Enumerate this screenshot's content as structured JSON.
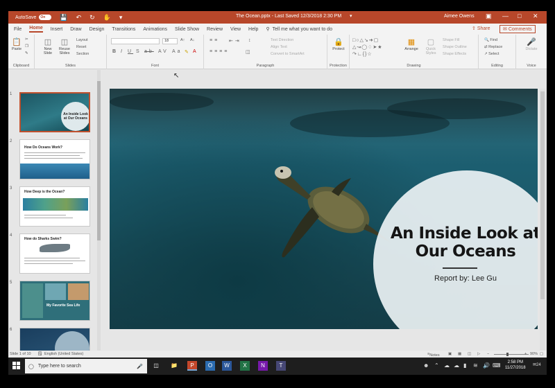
{
  "titlebar": {
    "autosave_label": "AutoSave",
    "autosave_state": "On",
    "title": "The Ocean.pptx  -  Last Saved  12/3/2018  2:30 PM",
    "user": "Aimee Owens"
  },
  "tabs": [
    "File",
    "Home",
    "Insert",
    "Draw",
    "Design",
    "Transitions",
    "Animations",
    "Slide Show",
    "Review",
    "View",
    "Help"
  ],
  "active_tab": "Home",
  "tell_me": "Tell me what you want to do",
  "share_label": "Share",
  "comments_label": "Comments",
  "ribbon": {
    "clipboard": {
      "label": "Clipboard",
      "paste": "Paste"
    },
    "slides": {
      "label": "Slides",
      "new_slide": "New Slide",
      "reuse_slides": "Reuse Slides",
      "layout": "Layout",
      "reset": "Reset",
      "section": "Section"
    },
    "font": {
      "label": "Font",
      "size": "18"
    },
    "paragraph": {
      "label": "Paragraph",
      "text_direction": "Text Direction",
      "align_text": "Align Text",
      "convert": "Convert to SmartArt"
    },
    "protection": {
      "label": "Protection",
      "protect": "Protect"
    },
    "drawing": {
      "label": "Drawing",
      "arrange": "Arrange",
      "quick_styles": "Quick Styles",
      "shape_fill": "Shape Fill",
      "shape_outline": "Shape Outline",
      "shape_effects": "Shape Effects"
    },
    "editing": {
      "label": "Editing",
      "find": "Find",
      "replace": "Replace",
      "select": "Select"
    },
    "voice": {
      "label": "Voice",
      "dictate": "Dictate"
    }
  },
  "thumbnails": [
    {
      "num": "1",
      "title": "An Inside Look at Our Oceans"
    },
    {
      "num": "2",
      "title": "How Do Oceans Work?"
    },
    {
      "num": "3",
      "title": "How Deep is the Ocean?"
    },
    {
      "num": "4",
      "title": "How do Sharks Swim?"
    },
    {
      "num": "5",
      "title": "My Favorite Sea Life"
    },
    {
      "num": "6",
      "title": ""
    }
  ],
  "slide": {
    "title": "An Inside Look at Our Oceans",
    "subtitle": "Report by: Lee Gu"
  },
  "status": {
    "slide_count": "Slide 1 of 10",
    "language": "English (United States)",
    "notes": "Notes",
    "zoom": "90%"
  },
  "taskbar": {
    "search_placeholder": "Type here to search",
    "time": "2:58 PM",
    "date": "11/27/2018",
    "notification_count": "24"
  }
}
